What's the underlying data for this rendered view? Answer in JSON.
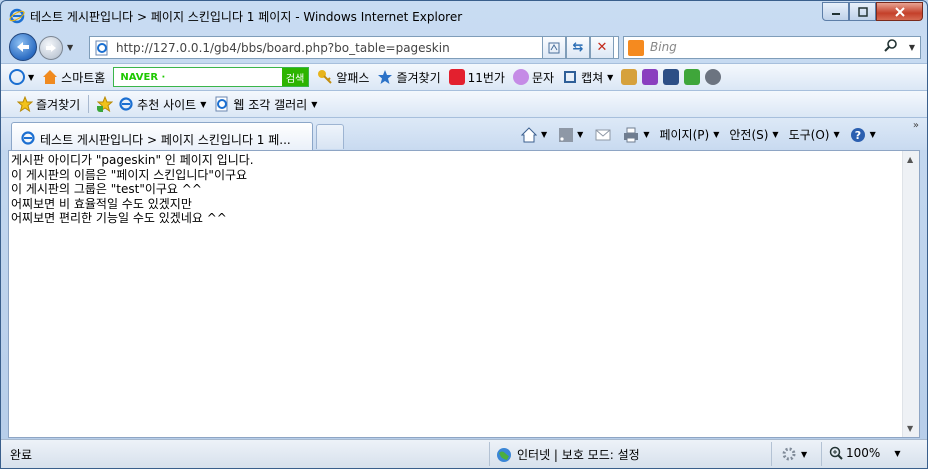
{
  "window": {
    "title": "테스트 게시판입니다 > 페이지 스킨입니다 1 페이지 - Windows Internet Explorer"
  },
  "nav": {
    "address": "http://127.0.0.1/gb4/bbs/board.php?bo_table=pageskin",
    "search_placeholder": "Bing"
  },
  "toolbar1": {
    "smart_home": "스마트홈",
    "naver_label": "NAVER ·",
    "naver_search": "검색",
    "alpass": "알패스",
    "favorites": "즐겨찾기",
    "eleven": "11번가",
    "sms": "문자",
    "capture": "캡쳐"
  },
  "toolbar2": {
    "favorites": "즐겨찾기",
    "suggested_sites": "추천 사이트",
    "web_slice": "웹 조각 갤러리"
  },
  "tab": {
    "title": "테스트 게시판입니다 > 페이지 스킨입니다 1 페..."
  },
  "commandbar": {
    "page": "페이지(P)",
    "safety": "안전(S)",
    "tools": "도구(O)"
  },
  "content": {
    "lines": [
      "게시판 아이디가 \"pageskin\" 인 페이지 입니다.",
      "이 게시판의 이름은 \"페이지 스킨입니다\"이구요",
      "이 게시판의 그룹은 \"test\"이구요 ^^",
      "어찌보면 비 효율적일 수도 있겠지만",
      "어찌보면 편리한 기능일 수도 있겠네요 ^^"
    ]
  },
  "status": {
    "text": "완료",
    "zone": "인터넷 | 보호 모드: 설정",
    "zoom": "100%"
  },
  "colors": {
    "chrome": "#c9dcf2",
    "close": "#c4402a",
    "naver": "#2db400"
  }
}
